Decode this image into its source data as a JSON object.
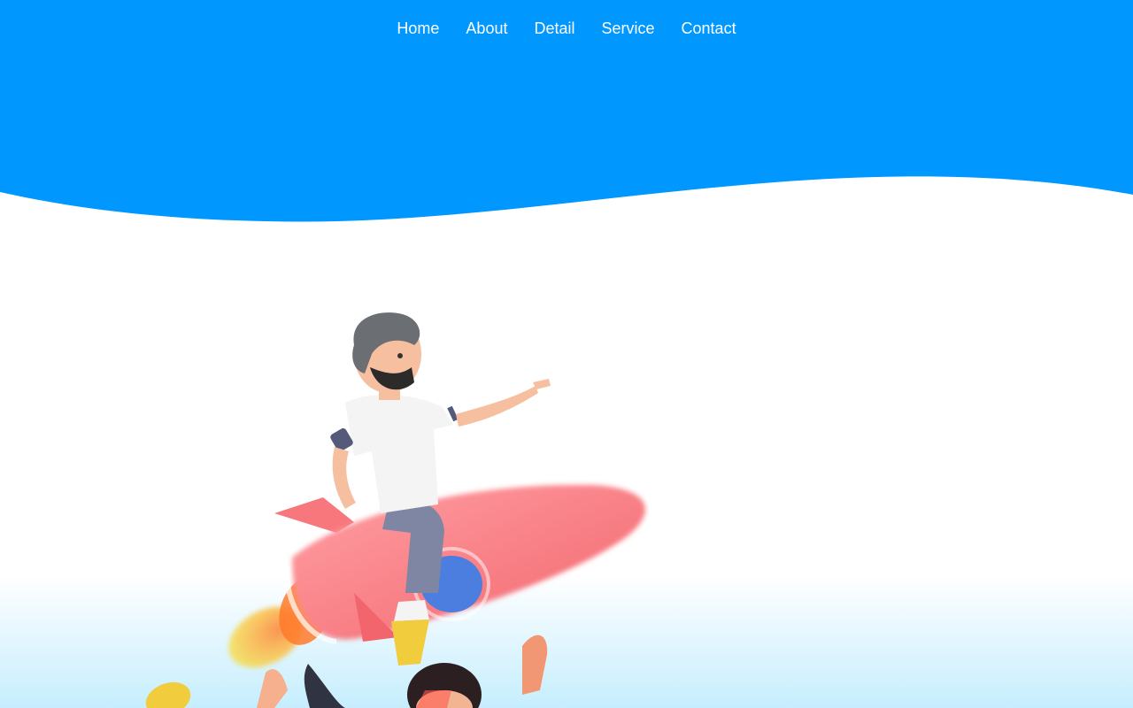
{
  "nav": {
    "items": [
      {
        "label": "Home"
      },
      {
        "label": "About"
      },
      {
        "label": "Detail"
      },
      {
        "label": "Service"
      },
      {
        "label": "Contact"
      }
    ]
  },
  "colors": {
    "hero_blue": "#0098ff",
    "bottom_tint": "#c6eefe",
    "rocket_red": "#f7777d",
    "shirt": "#f4f4f4",
    "pants": "#7f86a3",
    "hair": "#6b6e72",
    "skin": "#f6c0a0",
    "flame_yellow": "#f6e24c",
    "flame_orange": "#ff7a2a",
    "window_blue": "#4c7ee0",
    "shoe_yellow": "#f1cc3d"
  },
  "illustration": {
    "subject": "man riding rocket with people cheering below"
  }
}
